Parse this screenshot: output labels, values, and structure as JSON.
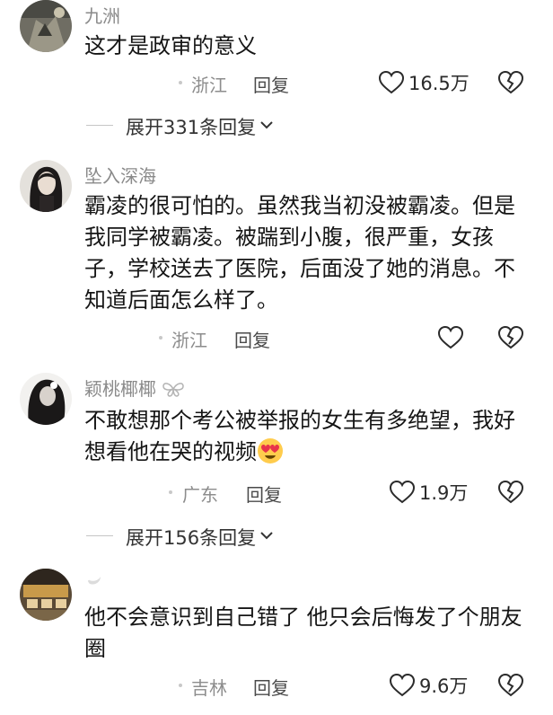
{
  "comments": [
    {
      "username": "九洲",
      "text": "这才是政审的意义",
      "location": "浙江",
      "reply_label": "回复",
      "likes": "16.5万",
      "expand_label": "展开331条回复"
    },
    {
      "username": "坠入深海",
      "text": "霸凌的很可怕的。虽然我当初没被霸凌。但是我同学被霸凌。被踹到小腹，很严重，女孩子，学校送去了医院，后面没了她的消息。不知道后面怎么样了。",
      "location": "浙江",
      "reply_label": "回复",
      "likes": ""
    },
    {
      "username": "颖桃椰椰",
      "text": "不敢想那个考公被举报的女生有多绝望，我好想看他在哭的视频",
      "emoji": "heart-eyes-emoji",
      "location": "广东",
      "reply_label": "回复",
      "likes": "1.9万",
      "expand_label": "展开156条回复"
    },
    {
      "username": "",
      "text": "他不会意识到自己错了 他只会后悔发了个朋友圈",
      "location": "吉林",
      "reply_label": "回复",
      "likes": "9.6万"
    }
  ],
  "colors": {
    "background": "#ffffff",
    "meta_gray": "#8d8d8d",
    "username_gray": "#8a8a8a",
    "text": "#151515"
  },
  "icons": {
    "like": "heart-outline-icon",
    "dislike": "broken-heart-icon",
    "expand": "chevron-down-icon"
  }
}
